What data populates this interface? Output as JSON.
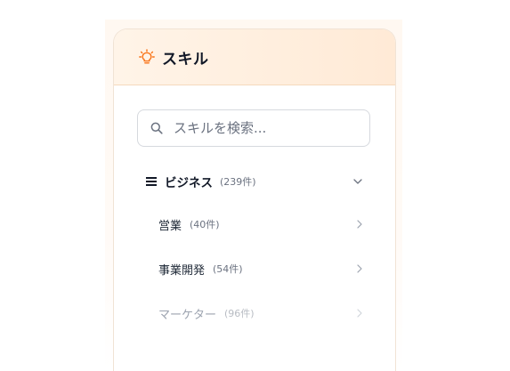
{
  "panel": {
    "title": "スキル",
    "icon": "lightbulb-icon",
    "accent_color": "#f97316"
  },
  "search": {
    "placeholder": "スキルを検索...",
    "value": "",
    "icon": "search-icon"
  },
  "categories": [
    {
      "label": "ビジネス",
      "count": "(239件)",
      "expanded": true,
      "icon": "menu-icon",
      "toggle_icon": "chevron-down-icon",
      "items": [
        {
          "label": "営業",
          "count": "(40件)",
          "icon": "chevron-right-icon"
        },
        {
          "label": "事業開発",
          "count": "(54件)",
          "icon": "chevron-right-icon"
        },
        {
          "label": "マーケター",
          "count": "(96件)",
          "icon": "chevron-right-icon"
        }
      ]
    }
  ]
}
